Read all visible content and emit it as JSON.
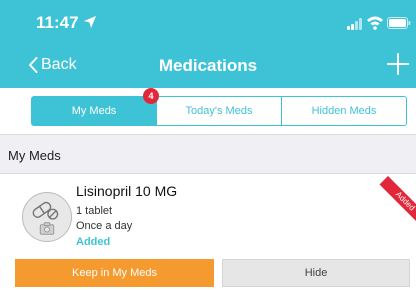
{
  "status_bar": {
    "time": "11:47",
    "icons": [
      "location-arrow-icon",
      "signal-icon",
      "wifi-icon",
      "battery-icon"
    ]
  },
  "nav": {
    "back_label": "Back",
    "title": "Medications",
    "add_icon": "plus-icon"
  },
  "tabs": [
    {
      "label": "My Meds",
      "active": true,
      "badge": "4"
    },
    {
      "label": "Today's Meds",
      "active": false
    },
    {
      "label": "Hidden Meds",
      "active": false
    }
  ],
  "section": {
    "title": "My Meds"
  },
  "medication": {
    "name": "Lisinopril 10 MG",
    "dose": "1 tablet",
    "frequency": "Once a day",
    "status": "Added",
    "ribbon": "Added",
    "avatar_icon": "pill-camera-icon"
  },
  "actions": {
    "keep_label": "Keep in My Meds",
    "hide_label": "Hide"
  },
  "colors": {
    "accent": "#3ec3d6",
    "badge": "#e0283a",
    "keep_button": "#f59a2f",
    "hide_button": "#e6e6e6",
    "section_bg": "#efeff4"
  }
}
